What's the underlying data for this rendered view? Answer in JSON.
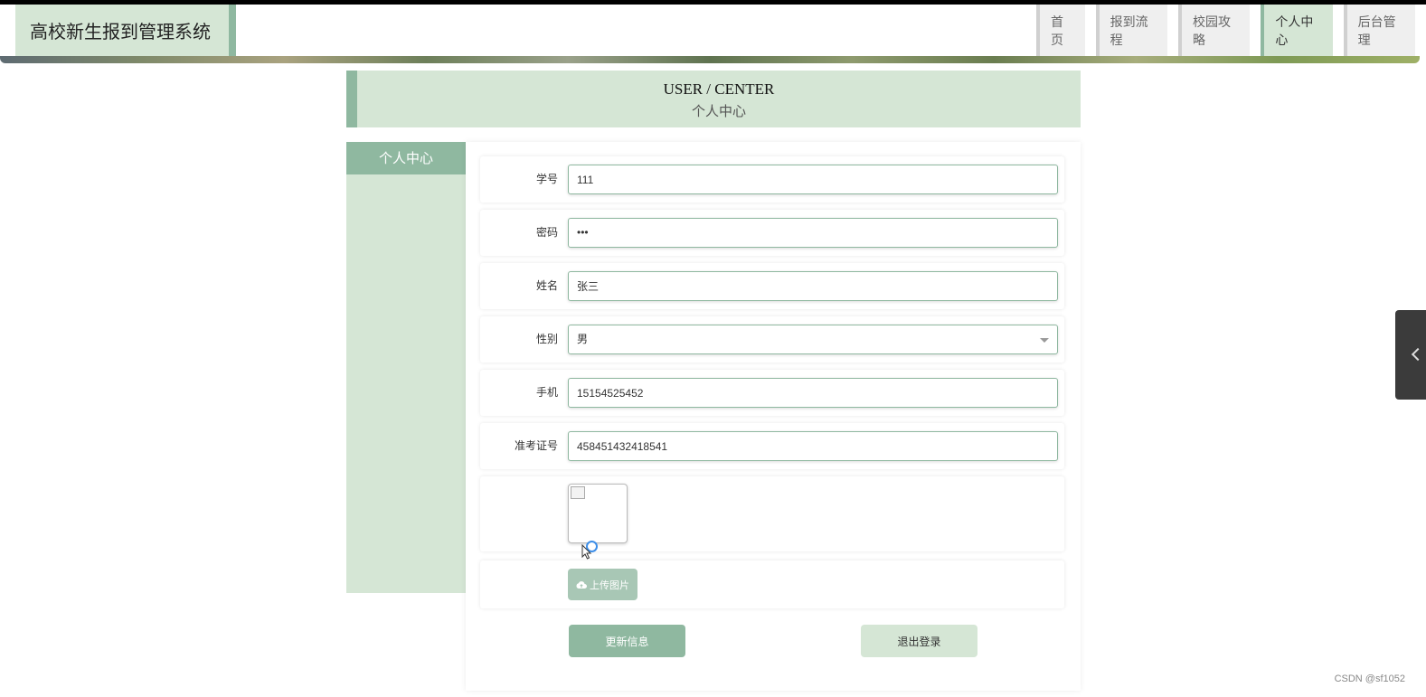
{
  "header": {
    "brand": "高校新生报到管理系统",
    "nav": [
      {
        "label": "首页",
        "active": false
      },
      {
        "label": "报到流程",
        "active": false
      },
      {
        "label": "校园攻略",
        "active": false
      },
      {
        "label": "个人中心",
        "active": true
      },
      {
        "label": "后台管理",
        "active": false
      }
    ]
  },
  "title": {
    "en": "USER / CENTER",
    "cn": "个人中心"
  },
  "sidebar": {
    "items": [
      {
        "label": "个人中心"
      }
    ]
  },
  "form": {
    "student_id": {
      "label": "学号",
      "value": "111"
    },
    "password": {
      "label": "密码",
      "value": "•••"
    },
    "name": {
      "label": "姓名",
      "value": "张三"
    },
    "gender": {
      "label": "性别",
      "value": "男"
    },
    "phone": {
      "label": "手机",
      "value": "15154525452"
    },
    "exam_number": {
      "label": "准考证号",
      "value": "458451432418541"
    },
    "upload_label": "上传图片",
    "update_label": "更新信息",
    "logout_label": "退出登录"
  },
  "colors": {
    "accent": "#8fb8a0",
    "light": "#d5e6d5"
  },
  "watermark": "CSDN @sf1052"
}
